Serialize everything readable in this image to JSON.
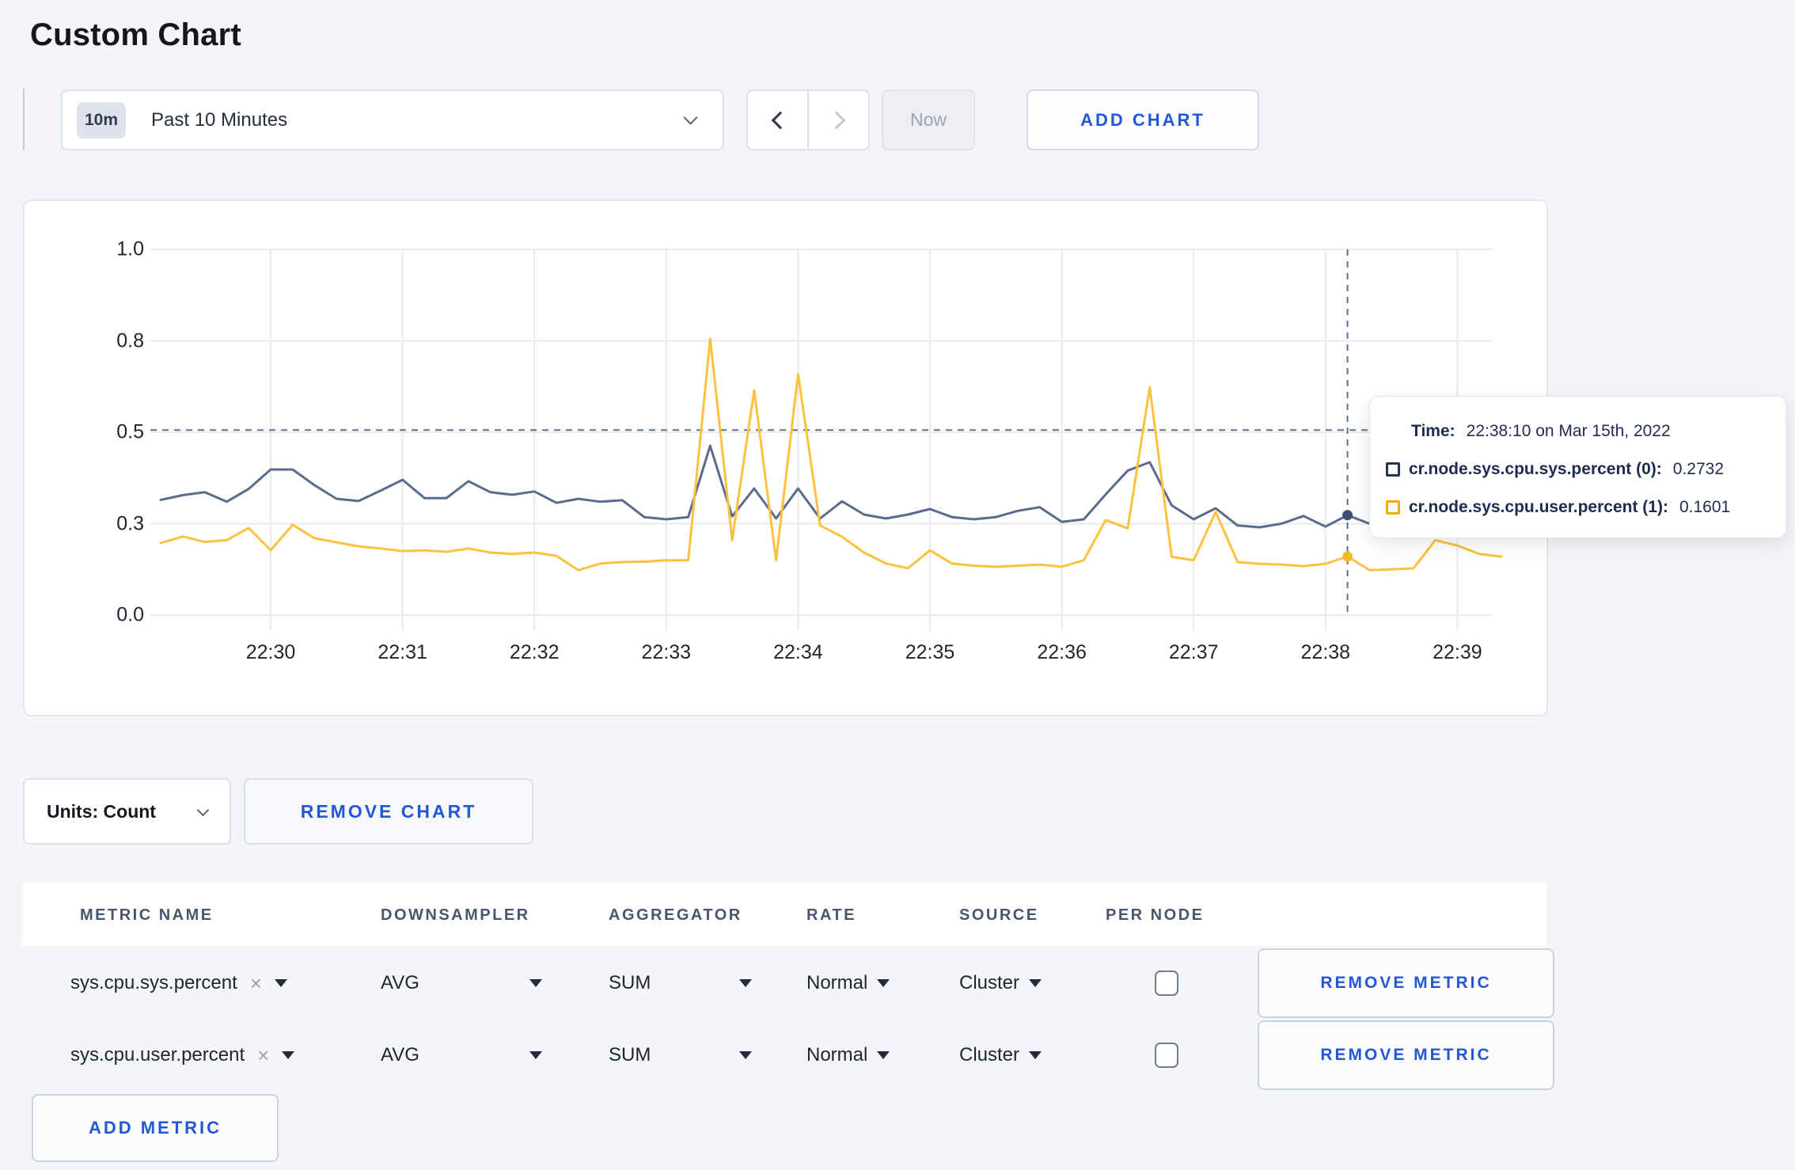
{
  "page": {
    "title": "Custom Chart"
  },
  "toolbar": {
    "time_window_badge": "10m",
    "time_window_label": "Past 10 Minutes",
    "now_label": "Now",
    "add_chart_label": "ADD CHART"
  },
  "tooltip": {
    "time_label": "Time:",
    "time_value": "22:38:10 on Mar 15th, 2022",
    "rows": [
      {
        "label": "cr.node.sys.cpu.sys.percent (0):",
        "value": "0.2732",
        "color": "#253457"
      },
      {
        "label": "cr.node.sys.cpu.user.percent (1):",
        "value": "0.1601",
        "color": "#f3ac00"
      }
    ]
  },
  "chart_controls": {
    "units_label": "Units: Count",
    "remove_chart_label": "REMOVE CHART"
  },
  "metrics_table": {
    "headers": [
      "METRIC NAME",
      "DOWNSAMPLER",
      "AGGREGATOR",
      "RATE",
      "SOURCE",
      "PER NODE"
    ],
    "rows": [
      {
        "metric": "sys.cpu.sys.percent",
        "downsampler": "AVG",
        "aggregator": "SUM",
        "rate": "Normal",
        "source": "Cluster",
        "per_node": false,
        "remove_label": "REMOVE METRIC"
      },
      {
        "metric": "sys.cpu.user.percent",
        "downsampler": "AVG",
        "aggregator": "SUM",
        "rate": "Normal",
        "source": "Cluster",
        "per_node": false,
        "remove_label": "REMOVE METRIC"
      }
    ],
    "add_metric_label": "ADD METRIC"
  },
  "chart_data": {
    "type": "line",
    "title": "",
    "xlabel": "",
    "ylabel": "",
    "ylim": [
      0,
      1
    ],
    "grid": true,
    "x_start": "22:29:10",
    "x_interval_seconds": 10,
    "x_axis_ticks": [
      "22:30",
      "22:31",
      "22:32",
      "22:33",
      "22:34",
      "22:35",
      "22:36",
      "22:37",
      "22:38",
      "22:39"
    ],
    "y_axis_ticks": [
      "0.0",
      "0.3",
      "0.5",
      "0.8",
      "1.0"
    ],
    "y_tick_values": [
      0,
      0.25,
      0.5,
      0.75,
      1.0
    ],
    "series": [
      {
        "name": "cr.node.sys.cpu.sys.percent",
        "color": "#5a6b8c",
        "values": [
          0.315,
          0.328,
          0.336,
          0.31,
          0.345,
          0.398,
          0.398,
          0.355,
          0.318,
          0.312,
          0.34,
          0.37,
          0.32,
          0.32,
          0.366,
          0.336,
          0.329,
          0.338,
          0.307,
          0.318,
          0.31,
          0.314,
          0.268,
          0.262,
          0.268,
          0.463,
          0.27,
          0.346,
          0.264,
          0.346,
          0.264,
          0.311,
          0.275,
          0.264,
          0.275,
          0.29,
          0.268,
          0.262,
          0.268,
          0.285,
          0.295,
          0.255,
          0.262,
          0.33,
          0.395,
          0.418,
          0.3,
          0.262,
          0.292,
          0.245,
          0.24,
          0.25,
          0.271,
          0.242,
          0.2732,
          0.25,
          0.262,
          0.255,
          0.266,
          0.27,
          0.272,
          0.27
        ]
      },
      {
        "name": "cr.node.sys.cpu.user.percent",
        "color": "#fcc23d",
        "values": [
          0.197,
          0.215,
          0.2,
          0.205,
          0.238,
          0.177,
          0.247,
          0.21,
          0.199,
          0.188,
          0.182,
          0.175,
          0.177,
          0.173,
          0.182,
          0.171,
          0.167,
          0.171,
          0.162,
          0.123,
          0.141,
          0.145,
          0.146,
          0.15,
          0.15,
          0.755,
          0.205,
          0.614,
          0.15,
          0.659,
          0.245,
          0.214,
          0.171,
          0.141,
          0.128,
          0.177,
          0.141,
          0.135,
          0.132,
          0.135,
          0.138,
          0.132,
          0.15,
          0.26,
          0.237,
          0.623,
          0.159,
          0.15,
          0.282,
          0.145,
          0.14,
          0.138,
          0.134,
          0.14,
          0.1601,
          0.123,
          0.125,
          0.128,
          0.205,
          0.19,
          0.167,
          0.16
        ]
      }
    ],
    "crosshair": {
      "time": "22:38:10",
      "index": 54,
      "hline_value": 0.506,
      "values": [
        0.2732,
        0.1601
      ]
    },
    "legend_position": "tooltip"
  }
}
